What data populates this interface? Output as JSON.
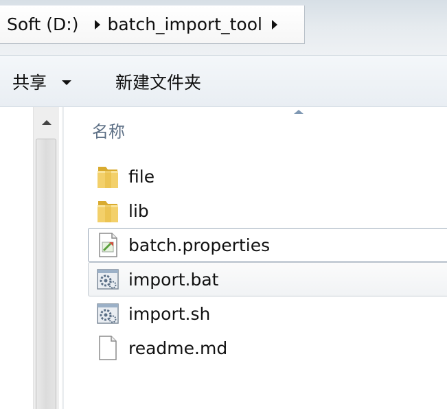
{
  "breadcrumb": {
    "items": [
      "Soft (D:)",
      "batch_import_tool"
    ]
  },
  "toolbar": {
    "share_label": "共享",
    "new_folder_label": "新建文件夹"
  },
  "file_list": {
    "column_name": "名称",
    "files": [
      {
        "name": "file",
        "icon": "folder-icon",
        "state": "normal"
      },
      {
        "name": "lib",
        "icon": "folder-icon",
        "state": "normal"
      },
      {
        "name": "batch.properties",
        "icon": "properties-file-icon",
        "state": "selected"
      },
      {
        "name": "import.bat",
        "icon": "batch-script-icon",
        "state": "hovered"
      },
      {
        "name": "import.sh",
        "icon": "batch-script-icon",
        "state": "normal"
      },
      {
        "name": "readme.md",
        "icon": "blank-document-icon",
        "state": "normal"
      }
    ]
  },
  "colors": {
    "address_bar_bg": "#e6ebef",
    "toolbar_bg": "#eef2f6",
    "header_text": "#5c6f85",
    "folder_yellow": "#e9c45a",
    "selection_border": "#99a7b7"
  }
}
